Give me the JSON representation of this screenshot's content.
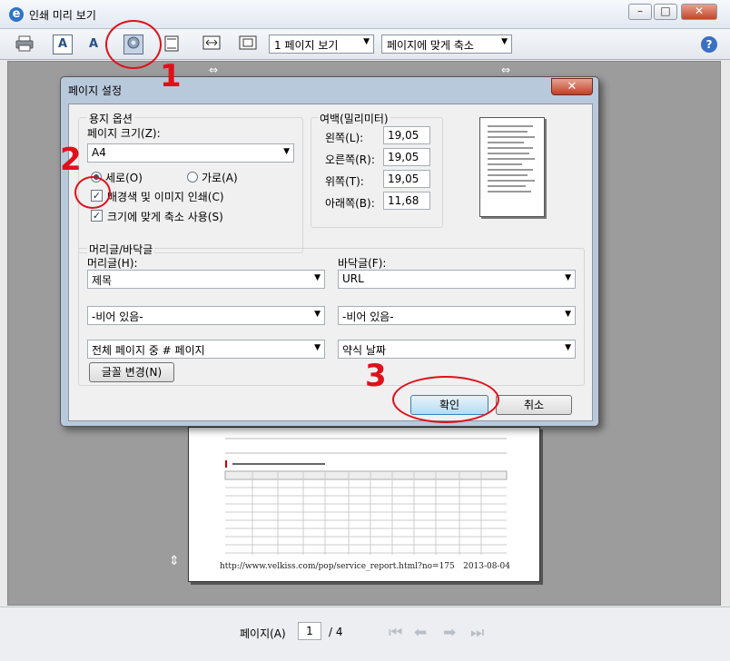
{
  "window": {
    "title": "인쇄 미리 보기",
    "minimize_glyph": "–",
    "maximize_glyph": "□",
    "close_glyph": "✕"
  },
  "toolbar": {
    "page_view_select": "1 페이지 보기",
    "fit_select": "페이지에 맞게 축소",
    "help_glyph": "?"
  },
  "icons": {
    "print": "print-icon",
    "portrait": "portrait-icon",
    "landscape": "landscape-icon",
    "page_setup": "gear-icon",
    "headers": "header-footer-icon",
    "full_width": "full-width-icon",
    "full_page": "full-page-icon"
  },
  "dialog": {
    "title": "페이지 설정",
    "close_glyph": "✕",
    "paper_options_label": "용지 옵션",
    "paper_size_label": "페이지 크기(Z):",
    "paper_size_value": "A4",
    "portrait_label": "세로(O)",
    "landscape_label": "가로(A)",
    "print_bg_label": "배경색 및 이미지 인쇄(C)",
    "shrink_fit_label": "크기에 맞게 축소 사용(S)",
    "margins_label": "여백(밀리미터)",
    "margin_left_label": "왼쪽(L):",
    "margin_left_value": "19,05",
    "margin_right_label": "오른쪽(R):",
    "margin_right_value": "19,05",
    "margin_top_label": "위쪽(T):",
    "margin_top_value": "19,05",
    "margin_bottom_label": "아래쪽(B):",
    "margin_bottom_value": "11,68",
    "hf_group_label": "머리글/바닥글",
    "header_label": "머리글(H):",
    "footer_label": "바닥글(F):",
    "header_1": "제목",
    "footer_1": "URL",
    "header_2": "-비어 있음-",
    "footer_2": "-비어 있음-",
    "header_3": "전체 페이지 중 # 페이지",
    "footer_3": "약식 날짜",
    "change_font_button": "글꼴 변경(N)",
    "ok_button": "확인",
    "cancel_button": "취소"
  },
  "annotations": {
    "one": "1",
    "two": "2",
    "three": "3"
  },
  "preview_page": {
    "footer_url": "http://www.velkiss.com/pop/service_report.html?no=175",
    "footer_date": "2013-08-04"
  },
  "status": {
    "page_label": "페이지(A)",
    "page_value": "1",
    "page_total": "/ 4"
  }
}
